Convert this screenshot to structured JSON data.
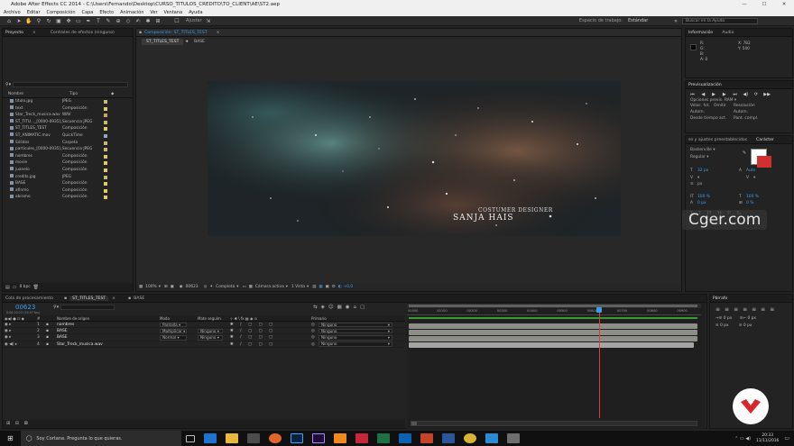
{
  "window": {
    "title": "Adobe After Effects CC 2014 - C:\\Users\\Fernando\\Desktop\\CURSO_TITULOS_CREDITO\\TO_CLIENT\\AE\\ST2.aep"
  },
  "menu": [
    "Archivo",
    "Editar",
    "Composición",
    "Capa",
    "Efecto",
    "Animación",
    "Ver",
    "Ventana",
    "Ayuda"
  ],
  "toolbar": {
    "align_label": "Ajustar",
    "workspace_label": "Espacio de trabajo:",
    "workspace_value": "Estándar",
    "search_placeholder": "Buscar en la Ayuda"
  },
  "project": {
    "tabs": [
      "Proyecto",
      "Controles de efectos (ninguno)"
    ],
    "headers": {
      "name": "Nombre",
      "type": "Tipo"
    },
    "bpc": "8 bpc",
    "items": [
      {
        "name": "titulo.jpg",
        "type": "JPEG",
        "color": "#c9b86a"
      },
      {
        "name": "text",
        "type": "Composición",
        "color": "#e4c95e"
      },
      {
        "name": "Star_Treck_musica.wav",
        "type": "WAV",
        "color": "#c9a36a"
      },
      {
        "name": "ST_TITU..._[0000-0935].jpg",
        "type": "Secuencia JPEG",
        "color": "#c9b86a"
      },
      {
        "name": "ST_TITLES_TEST",
        "type": "Composición",
        "color": "#e4c95e"
      },
      {
        "name": "ST_ANIMATIC.mov",
        "type": "QuickTime",
        "color": "#8fa7c7"
      },
      {
        "name": "Sólidos",
        "type": "Carpeta",
        "color": "#c9b86a"
      },
      {
        "name": "particules_[0000-0935].jpg",
        "type": "Secuencia JPEG",
        "color": "#c9b86a"
      },
      {
        "name": "nombres",
        "type": "Composición",
        "color": "#e4c95e"
      },
      {
        "name": "movie",
        "type": "Composición",
        "color": "#e4c95e"
      },
      {
        "name": "juanelo",
        "type": "Composición",
        "color": "#e4c95e"
      },
      {
        "name": "credits.jpg",
        "type": "JPEG",
        "color": "#c9b86a"
      },
      {
        "name": "BASE",
        "type": "Composición",
        "color": "#e4c95e"
      },
      {
        "name": "afinmo",
        "type": "Composición",
        "color": "#e4c95e"
      },
      {
        "name": "abramo",
        "type": "Composición",
        "color": "#e4c95e"
      }
    ]
  },
  "composition": {
    "panel_tab": "Composición: ST_TITLES_TEST",
    "tabs": [
      "ST_TITLES_TEST",
      "BASE"
    ],
    "credit_role": "COSTUMER DESIGNER",
    "credit_name": "SANJA HAIS",
    "watermark": "Cger.com",
    "footer": {
      "zoom": "100%",
      "timecode": "00623",
      "resolution": "Completa",
      "camera": "Cámara activa",
      "views": "1 Vista",
      "offset": "+0,0"
    }
  },
  "timeline": {
    "tabs": [
      "Cola de procesamiento",
      "ST_TITLES_TEST",
      "BASE"
    ],
    "timecode": "00623",
    "sub_timecode": "0:00:20:23 (29,97 fps)",
    "headers": {
      "num": "#",
      "name": "Nombre de origen",
      "mode": "Modo",
      "matte": "Mate seguim.",
      "parent": "Primario"
    },
    "ruler": [
      "00000",
      "00100",
      "00200",
      "00300",
      "00400",
      "00500",
      "00600",
      "00700",
      "00800",
      "00900"
    ],
    "playhead_pct": 0.66,
    "layers": [
      {
        "num": "1",
        "name": "nombres",
        "mode": "Pantalla",
        "matte": "",
        "parent": "Ninguno",
        "bar_color": "#8c8e87"
      },
      {
        "num": "2",
        "name": "BASE",
        "mode": "Multiplicar",
        "matte": "Ninguno",
        "parent": "Ninguno",
        "bar_color": "#8c8e87"
      },
      {
        "num": "3",
        "name": "BASE",
        "mode": "Normal",
        "matte": "Ninguno",
        "parent": "Ninguno",
        "bar_color": "#8c8e87"
      },
      {
        "num": "4",
        "name": "Star_Treck_musica.wav",
        "mode": "",
        "matte": "",
        "parent": "Ninguno",
        "bar_color": "#a5a5a5"
      }
    ]
  },
  "info": {
    "tabs": [
      "Información",
      "Audio"
    ],
    "r": "R:",
    "g": "G:",
    "b": "B:",
    "a": "A: 0",
    "x": "X: 782",
    "y": "Y: 540"
  },
  "preview": {
    "title": "Previsualización",
    "options_label": "Opciones previs. RAM",
    "frame_rate": "Veloc. fot.",
    "skip": "Omitir",
    "resolution": "Resolución",
    "auto1": "Autom.",
    "auto2": "Autom.",
    "from_label": "Desde tiempo act.",
    "fullscreen": "Pant. compl."
  },
  "character": {
    "tabs": [
      "es y ajustes preestablecidos",
      "Carácter"
    ],
    "font": "Baskerville",
    "style": "Regular",
    "size": "32 px",
    "auto": "Auto",
    "px": "px",
    "scale_v": "100 %",
    "scale_h": "100 %",
    "baseline": "0 px",
    "tsume": "0 %"
  },
  "paragraph": {
    "title": "Párrafo"
  },
  "taskbar": {
    "search_text": "Soy Cortana. Pregunta lo que quieras.",
    "time": "20:33",
    "date": "11/11/2016"
  }
}
